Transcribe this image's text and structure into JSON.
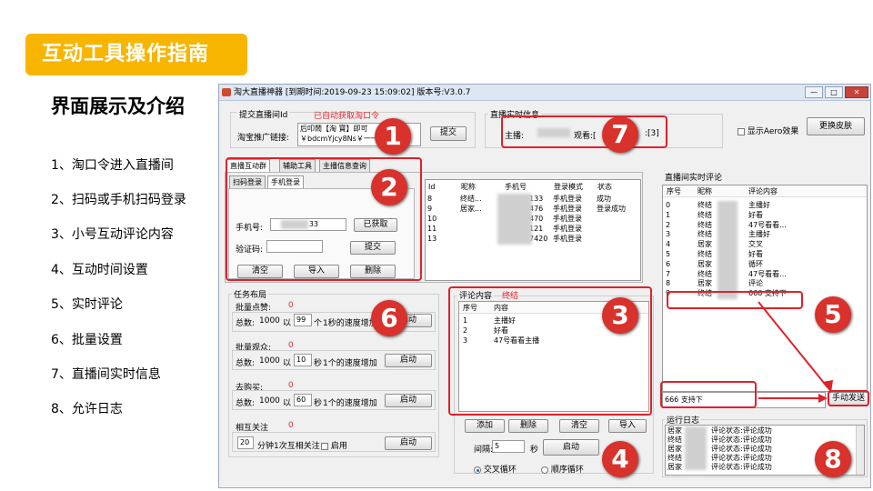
{
  "slide": {
    "title": "互动工具操作指南",
    "subtitle": "界面展示及介绍",
    "steps": [
      "1、淘口令进入直播间",
      "2、扫码或手机扫码登录",
      "3、小号互动评论内容",
      "4、互动时间设置",
      "5、实时评论",
      "6、批量设置",
      "7、直播间实时信息",
      "8、允许日志"
    ],
    "badges": [
      "1",
      "2",
      "3",
      "4",
      "5",
      "6",
      "7",
      "8"
    ]
  },
  "window": {
    "title": "淘大直播神器 [到期时间:2019-09-23 15:09:02]   版本号:V3.0.7",
    "controls": {
      "min": "—",
      "max": "□",
      "close": "✕"
    },
    "top": {
      "group_label": "提交直播间Id",
      "hint": "已自动获取淘口令",
      "link_label": "淘宝推广链接:",
      "link_value": "后叩鬧【淘 寶】即可",
      "link_value2": "￥bdcmYjcy8Ns￥一一",
      "submit": "提交",
      "live_group": "直播实时信息",
      "anchor_label": "主播:",
      "viewers_label": "观看:[",
      "likes_value": ":[3]",
      "aero_label": "显示Aero效果",
      "skin_button": "更换皮肤"
    },
    "tabs": [
      "直播互动群",
      "辅助工具",
      "主播信息查询"
    ],
    "subtabs": [
      "扫码登录",
      "手机登录"
    ],
    "login": {
      "phone_label": "手机号:",
      "phone_value": "33",
      "get_code": "已获取",
      "code_label": "验证码:",
      "submit": "提交",
      "clear": "清空",
      "import": "导入",
      "delete": "删除"
    },
    "accounts": {
      "headers": [
        "Id",
        "昵称",
        "手机号",
        "登录模式",
        "状态"
      ],
      "rows": [
        {
          "id": "8",
          "nick": "终结...",
          "phone": "133",
          "mode": "手机登录",
          "status": "成功"
        },
        {
          "id": "9",
          "nick": "居家...",
          "phone": "476",
          "mode": "手机登录",
          "status": "登录成功"
        },
        {
          "id": "10",
          "nick": "",
          "phone": "470",
          "mode": "手机登录",
          "status": ""
        },
        {
          "id": "11",
          "nick": "",
          "phone": "121",
          "mode": "手机登录",
          "status": ""
        },
        {
          "id": "13",
          "nick": "",
          "phone": "7420",
          "mode": "手机登录",
          "status": ""
        }
      ]
    },
    "tasks": {
      "group_label": "任务布局",
      "likes": {
        "label": "批量点赞:",
        "count": "0",
        "total_label": "总数:",
        "total": "1000",
        "by": "以",
        "rate": "99",
        "unit": "个",
        "speed": "1秒的速度增加",
        "start": "启动"
      },
      "watch": {
        "label": "批量观众:",
        "count": "0",
        "total_label": "总数:",
        "total": "1000",
        "by": "以",
        "rate": "10",
        "unit": "秒",
        "speed": "1个的速度增加",
        "start": "启动"
      },
      "buy": {
        "label": "去购买:",
        "count": "0",
        "total_label": "总数:",
        "total": "1000",
        "by": "以",
        "rate": "60",
        "unit": "秒",
        "speed": "1个的速度增加",
        "start": "启动"
      },
      "follow": {
        "label": "相互关注",
        "count": "0",
        "interval": "20",
        "text": "分钟1次互相关注",
        "enable": "启用",
        "start": "启动"
      }
    },
    "comments": {
      "group_label": "评论内容",
      "account": "终结",
      "headers": [
        "序号",
        "内容"
      ],
      "rows": [
        {
          "no": "1",
          "text": "主播好"
        },
        {
          "no": "2",
          "text": "好看"
        },
        {
          "no": "3",
          "text": "47号看看主播"
        }
      ],
      "add": "添加",
      "delete": "删除",
      "clear": "清空",
      "import": "导入",
      "interval_label": "间隔:",
      "interval_value": "5",
      "interval_unit": "秒",
      "start": "启动",
      "cross": "交叉循环",
      "seq": "顺序循环"
    },
    "realtime": {
      "group_label": "直播间实时评论",
      "headers": [
        "序号",
        "昵称",
        "评论内容"
      ],
      "rows": [
        {
          "no": "0",
          "nick": "终结",
          "text": "主播好"
        },
        {
          "no": "1",
          "nick": "终结",
          "text": "好看"
        },
        {
          "no": "2",
          "nick": "终结",
          "text": "47号看看..."
        },
        {
          "no": "3",
          "nick": "终结",
          "text": "主播好"
        },
        {
          "no": "4",
          "nick": "居家",
          "text": "交叉"
        },
        {
          "no": "5",
          "nick": "终结",
          "text": "好看"
        },
        {
          "no": "6",
          "nick": "居家",
          "text": "循环"
        },
        {
          "no": "7",
          "nick": "终结",
          "text": "47号看看..."
        },
        {
          "no": "8",
          "nick": "居家",
          "text": "评论"
        },
        {
          "no": "9",
          "nick": "终结",
          "text": "666 支持下"
        }
      ],
      "input_value": "666 支持下",
      "send": "手动发送"
    },
    "log": {
      "group_label": "运行日志",
      "lines": [
        {
          "who": "居家",
          "text": "评论状态:评论成功"
        },
        {
          "who": "终结",
          "text": "评论状态:评论成功"
        },
        {
          "who": "居家",
          "text": "评论状态:评论成功"
        },
        {
          "who": "终结",
          "text": "评论状态:评论成功"
        },
        {
          "who": "居家",
          "text": "评论状态:评论成功"
        }
      ]
    }
  },
  "colors": {
    "accent": "#f7b500",
    "highlight": "#e0212a",
    "badge": "#d9312b"
  }
}
